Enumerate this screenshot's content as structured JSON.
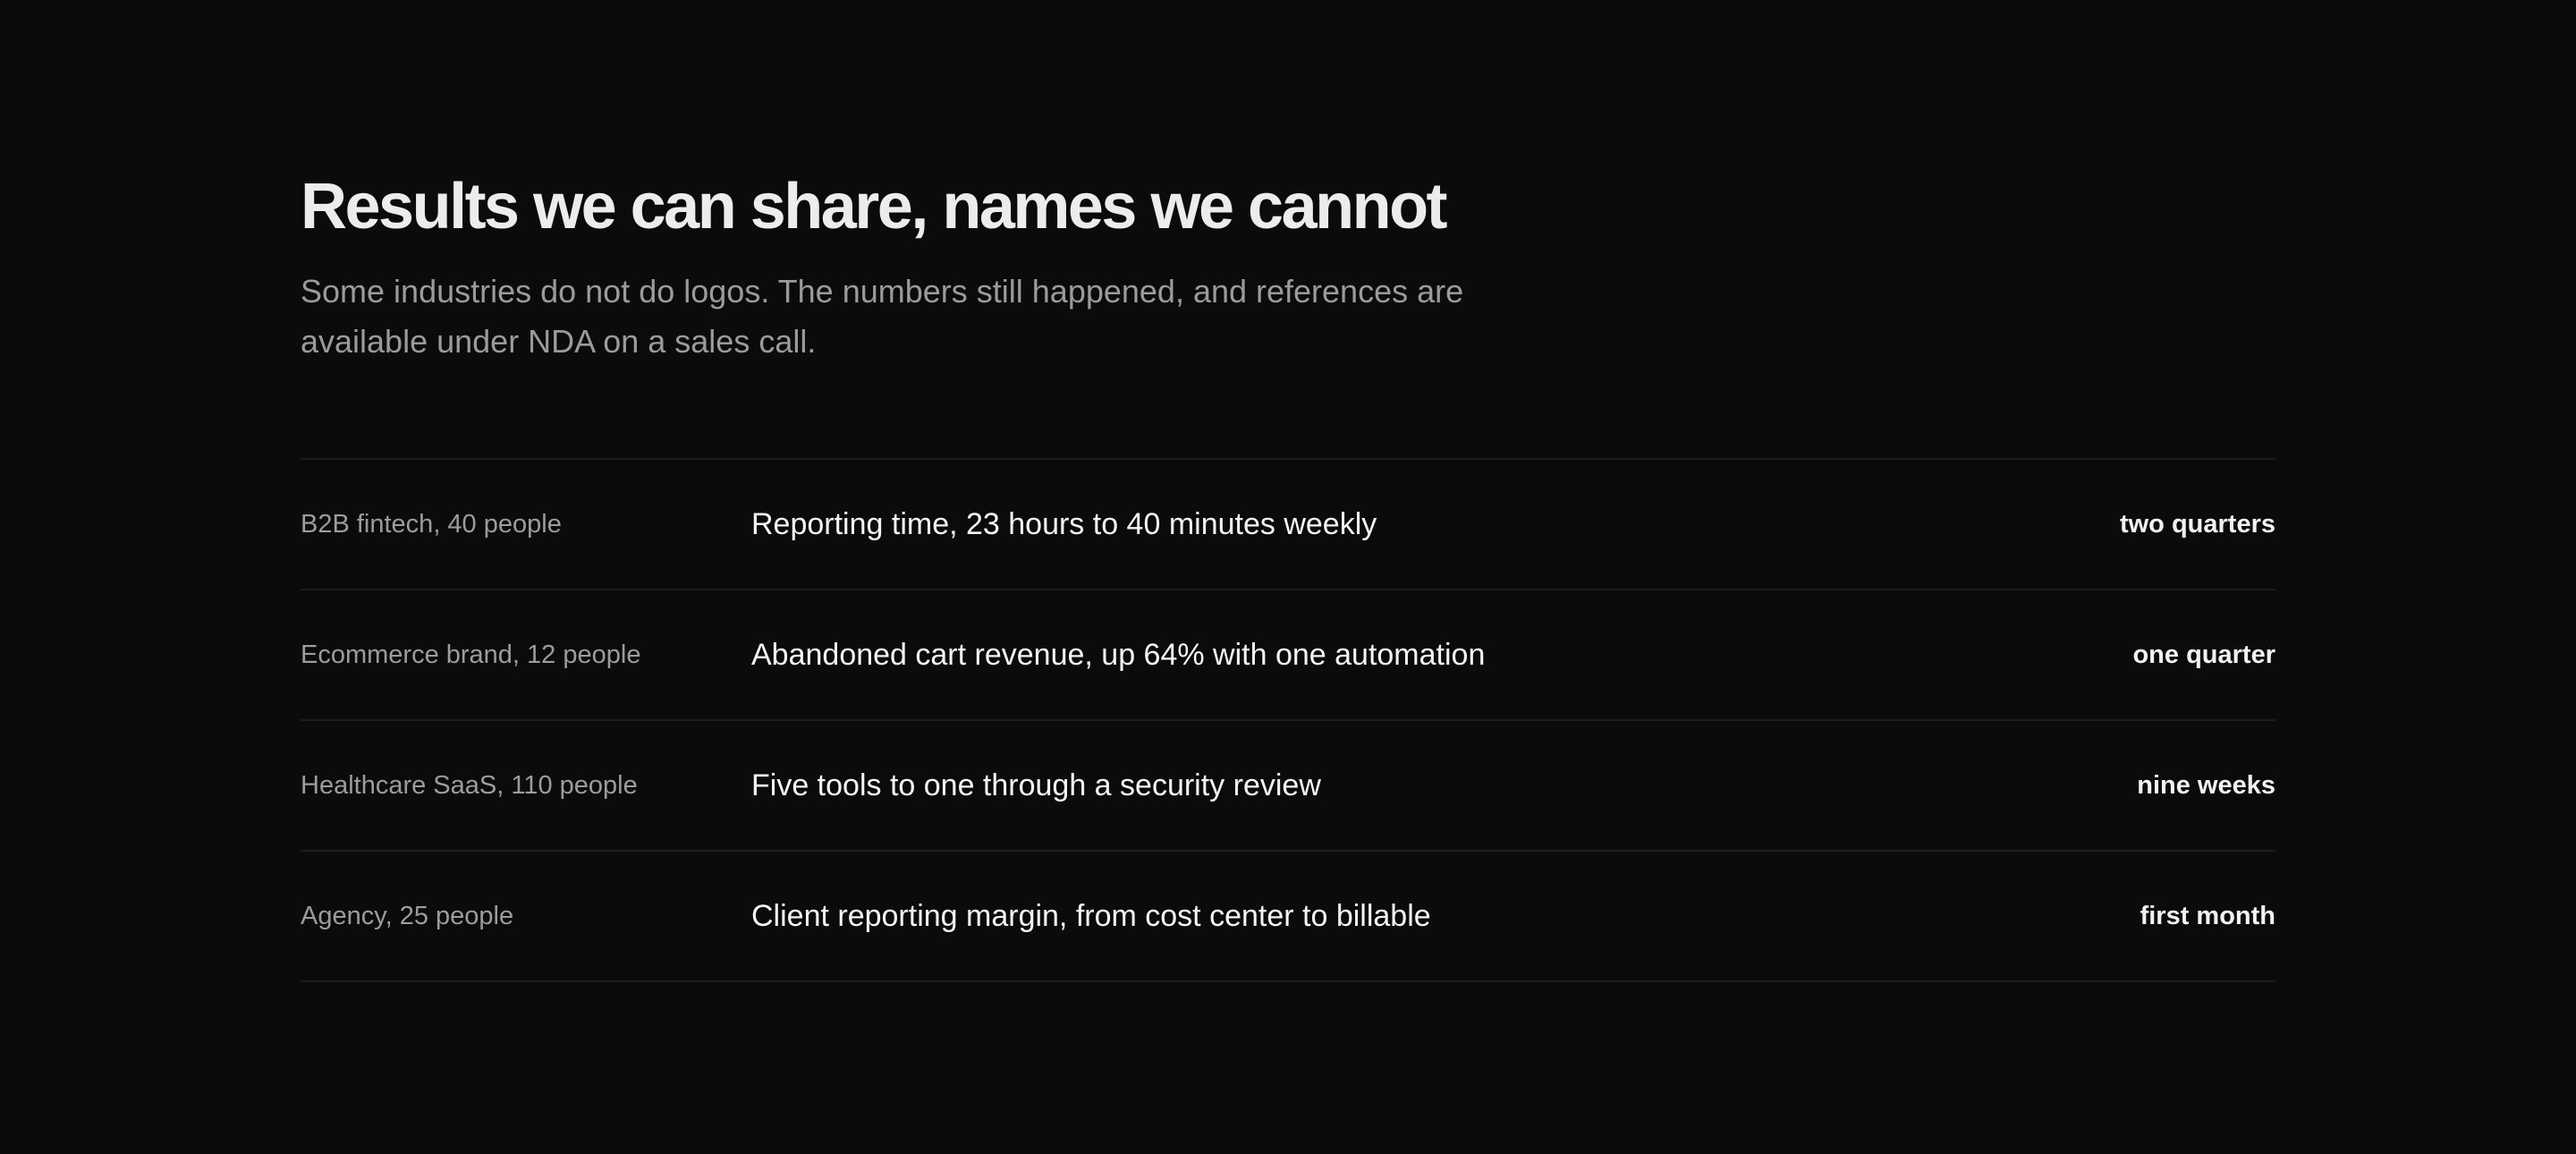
{
  "header": {
    "title": "Results we can share, names we cannot",
    "subtitle": "Some industries do not do logos. The numbers still happened, and references are available under NDA on a sales call."
  },
  "results": [
    {
      "company": "B2B fintech, 40 people",
      "outcome": "Reporting time, 23 hours to 40 minutes weekly",
      "timeline": "two quarters"
    },
    {
      "company": "Ecommerce brand, 12 people",
      "outcome": "Abandoned cart revenue, up 64% with one automation",
      "timeline": "one quarter"
    },
    {
      "company": "Healthcare SaaS, 110 people",
      "outcome": "Five tools to one through a security review",
      "timeline": "nine weeks"
    },
    {
      "company": "Agency, 25 people",
      "outcome": "Client reporting margin, from cost center to billable",
      "timeline": "first month"
    }
  ],
  "colors": {
    "background": "#0b0b0b",
    "title": "#ececec",
    "muted": "#9b9b9b",
    "divider": "#1e1e1e"
  }
}
